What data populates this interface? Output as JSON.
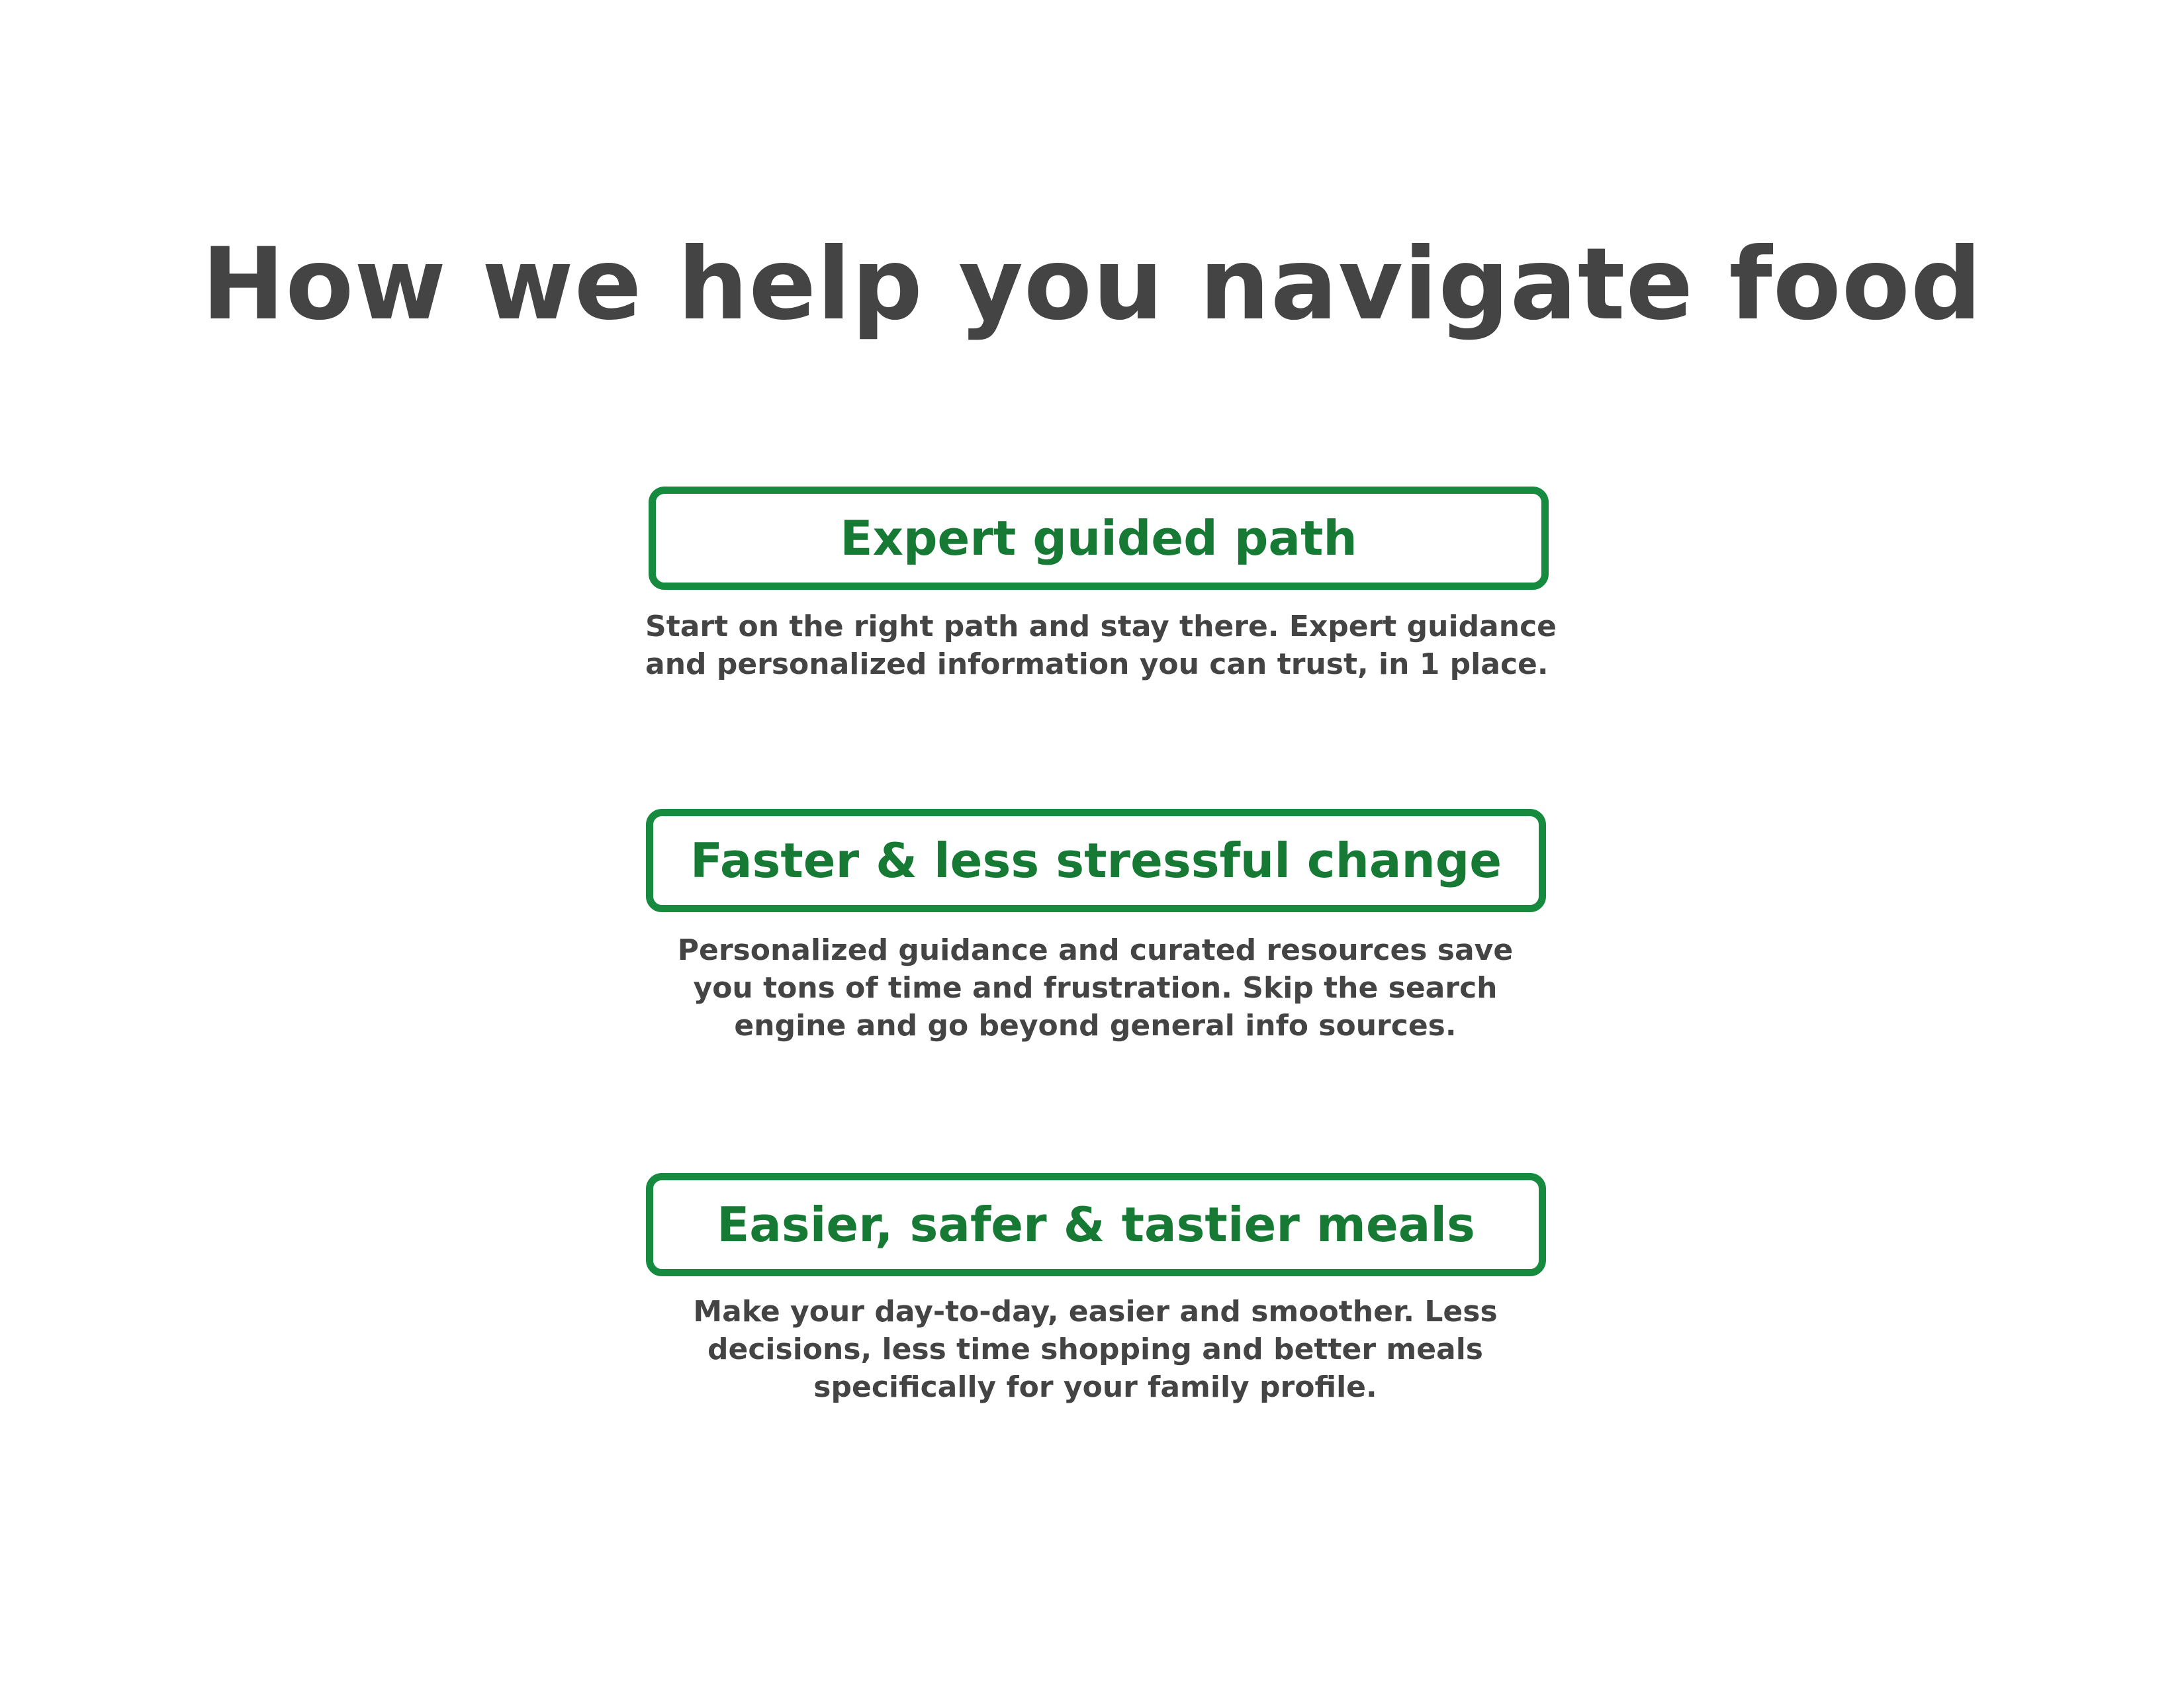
{
  "page": {
    "title": "How we help you navigate food"
  },
  "features": [
    {
      "title": "Expert guided path",
      "description_lines": [
        "Start on the right path and stay there. Expert guidance",
        "and personalized information you can trust, in 1 place."
      ]
    },
    {
      "title": "Faster & less stressful change",
      "description_lines": [
        "Personalized guidance and curated resources save",
        "you tons of time and frustration. Skip the search",
        "engine and go beyond general info sources."
      ]
    },
    {
      "title": "Easier, safer & tastier meals",
      "description_lines": [
        "Make your day-to-day, easier and smoother. Less",
        "decisions, less time shopping and better meals",
        "specifically for your family profile."
      ]
    }
  ],
  "colors": {
    "accent_green": "#168a3e",
    "title_green": "#167a35",
    "text_gray": "#444444",
    "background": "#ffffff"
  }
}
